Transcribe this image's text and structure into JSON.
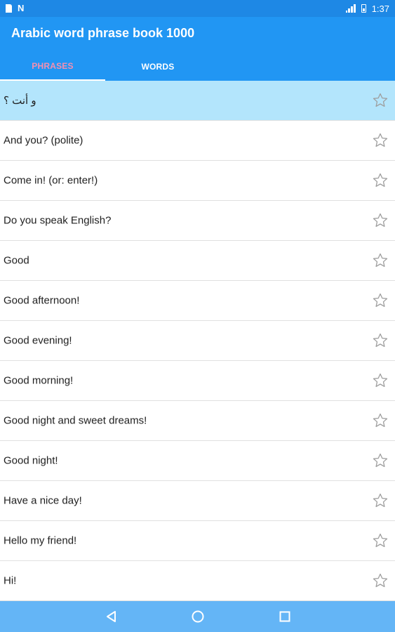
{
  "status_bar": {
    "time": "1:37",
    "icons": [
      "sim-icon",
      "nfc-icon",
      "signal-icon",
      "battery-icon"
    ]
  },
  "app_bar": {
    "title": "Arabic word phrase book 1000",
    "tabs": [
      {
        "label": "PHRASES",
        "active": true
      },
      {
        "label": "WORDS",
        "active": false
      }
    ]
  },
  "list": {
    "items": [
      {
        "label": "و أنت ؟",
        "highlighted": true
      },
      {
        "label": "And you? (polite)"
      },
      {
        "label": "Come in! (or: enter!)"
      },
      {
        "label": "Do you speak English?"
      },
      {
        "label": "Good"
      },
      {
        "label": "Good afternoon!"
      },
      {
        "label": "Good evening!"
      },
      {
        "label": "Good morning!"
      },
      {
        "label": "Good night and sweet dreams!"
      },
      {
        "label": "Good night!"
      },
      {
        "label": "Have a nice day!"
      },
      {
        "label": "Hello my friend!"
      },
      {
        "label": "Hi!"
      }
    ]
  },
  "nav_bar": {
    "buttons": [
      "back-icon",
      "home-icon",
      "recents-icon"
    ]
  },
  "colors": {
    "status_bar": "#1e88e5",
    "app_bar": "#2196f3",
    "active_tab_text": "#f48fb1",
    "highlight_row": "#b3e5fc",
    "nav_bar": "#64b5f6"
  }
}
